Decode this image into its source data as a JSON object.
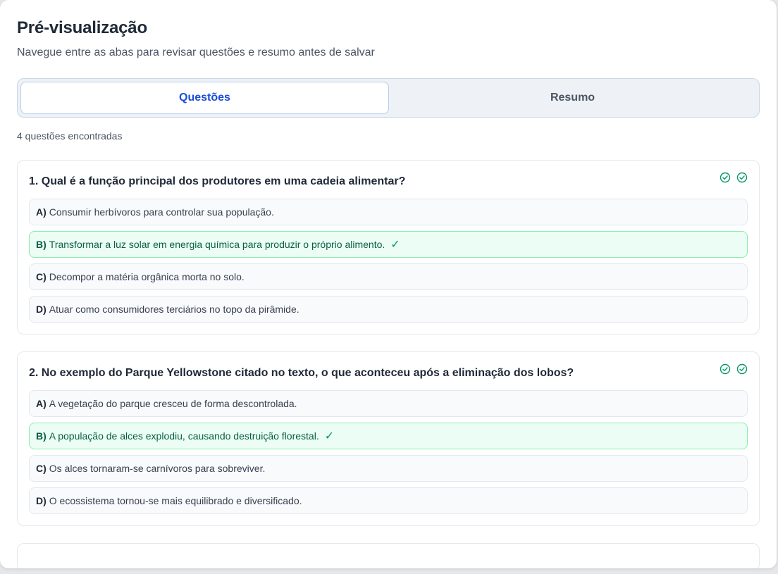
{
  "header": {
    "title": "Pré-visualização",
    "subtitle": "Navegue entre as abas para revisar questões e resumo antes de salvar"
  },
  "tabs": [
    {
      "label": "Questões",
      "active": true
    },
    {
      "label": "Resumo",
      "active": false
    }
  ],
  "count_text": "4 questões encontradas",
  "colors": {
    "accent": "#1d4ed8",
    "correct_bg": "#ecfdf5",
    "correct_border": "#86efac",
    "check_icon": "#059669"
  },
  "questions": [
    {
      "text": "1. Qual é a função principal dos produtores em uma cadeia alimentar?",
      "icons": [
        "check-circle-icon",
        "check-circle-icon"
      ],
      "options": [
        {
          "letter": "A)",
          "text": "Consumir herbívoros para controlar sua população.",
          "correct": false
        },
        {
          "letter": "B)",
          "text": "Transformar a luz solar em energia química para produzir o próprio alimento.",
          "correct": true,
          "mark": "✓"
        },
        {
          "letter": "C)",
          "text": "Decompor a matéria orgânica morta no solo.",
          "correct": false
        },
        {
          "letter": "D)",
          "text": "Atuar como consumidores terciários no topo da pirâmide.",
          "correct": false
        }
      ]
    },
    {
      "text": "2. No exemplo do Parque Yellowstone citado no texto, o que aconteceu após a eliminação dos lobos?",
      "icons": [
        "check-circle-icon",
        "check-circle-icon"
      ],
      "options": [
        {
          "letter": "A)",
          "text": "A vegetação do parque cresceu de forma descontrolada.",
          "correct": false
        },
        {
          "letter": "B)",
          "text": "A população de alces explodiu, causando destruição florestal.",
          "correct": true,
          "mark": "✓"
        },
        {
          "letter": "C)",
          "text": "Os alces tornaram-se carnívoros para sobreviver.",
          "correct": false
        },
        {
          "letter": "D)",
          "text": "O ecossistema tornou-se mais equilibrado e diversificado.",
          "correct": false
        }
      ]
    }
  ]
}
